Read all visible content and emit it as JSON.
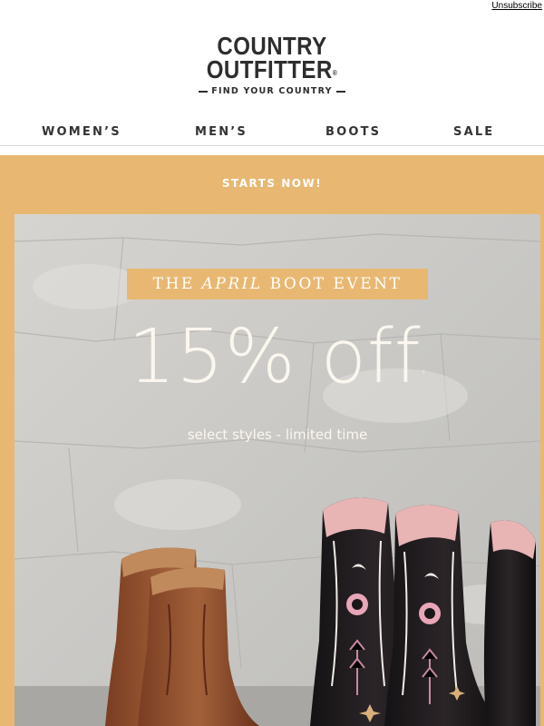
{
  "header": {
    "unsubscribe": "Unsubscribe"
  },
  "logo": {
    "line1": "COUNTRY",
    "line2": "OUTFITTER",
    "registered": "®",
    "tagline": "FIND YOUR COUNTRY"
  },
  "nav": {
    "items": [
      {
        "label": "WOMEN’S"
      },
      {
        "label": "MEN’S"
      },
      {
        "label": "BOOTS"
      },
      {
        "label": "SALE"
      }
    ]
  },
  "banner": {
    "kicker": "STARTS NOW!",
    "event_prefix": "THE ",
    "event_month": "APRIL",
    "event_suffix": " BOOT EVENT",
    "discount": "15% off",
    "asterisk": "*",
    "subtitle": "select styles - limited time"
  },
  "colors": {
    "banner_bg": "#e8b872",
    "nav_text": "#333333",
    "hero_text": "#fbf7ef"
  }
}
